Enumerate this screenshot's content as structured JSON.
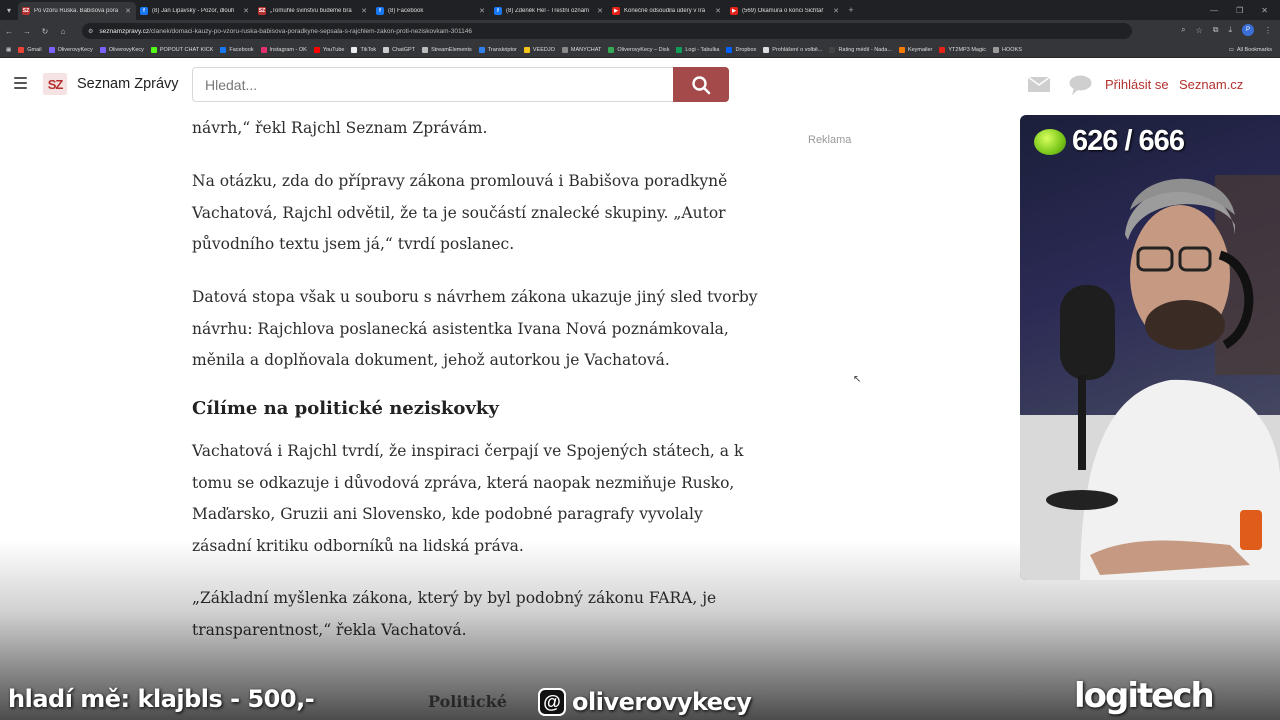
{
  "browser": {
    "tabs": [
      {
        "title": "Po vzoru Ruska. Babišova pora",
        "color": "#b5312f",
        "fav": "SZ",
        "active": true
      },
      {
        "title": "(8) Jan Lipavský - Pozor, dlouh",
        "color": "#1877f2",
        "fav": "f",
        "active": false
      },
      {
        "title": "„Tomuhle svinstvu budeme brá",
        "color": "#b5312f",
        "fav": "SZ",
        "active": false
      },
      {
        "title": "(8) Facebook",
        "color": "#1877f2",
        "fav": "f",
        "active": false
      },
      {
        "title": "(8) Zdeněk Hel - Trestní oznám",
        "color": "#1877f2",
        "fav": "f",
        "active": false
      },
      {
        "title": "Konečně odsoudila údery v Írá",
        "color": "#e62117",
        "fav": "▶",
        "active": false
      },
      {
        "title": "(569) Okamura o konci Šichtař",
        "color": "#e62117",
        "fav": "▶",
        "active": false
      }
    ],
    "new_tab": "+",
    "url_host": "seznamzpravy.cz",
    "url_path": "/clanek/domaci-kauzy-po-vzoru-ruska-babisova-poradkyne-sepsala-s-rajchlem-zakon-proti-neziskovkam-301146",
    "bookmarks": [
      {
        "label": "Gmail",
        "color": "#ea4335"
      },
      {
        "label": "OliverovyKecy",
        "color": "#7b61ff"
      },
      {
        "label": "OliverovyKecy",
        "color": "#7b61ff"
      },
      {
        "label": "POPOUT CHAT KICK",
        "color": "#53fc18"
      },
      {
        "label": "Facebook",
        "color": "#1877f2"
      },
      {
        "label": "Instagram - OK",
        "color": "#e1306c"
      },
      {
        "label": "YouTube",
        "color": "#ff0000"
      },
      {
        "label": "TikTok",
        "color": "#eeeeee"
      },
      {
        "label": "ChatGPT",
        "color": "#cccccc"
      },
      {
        "label": "StreamElements",
        "color": "#bbbbbb"
      },
      {
        "label": "Transkriptor",
        "color": "#2f80ed"
      },
      {
        "label": "VEEDJO",
        "color": "#f5c518"
      },
      {
        "label": "MANYCHAT",
        "color": "#888888"
      },
      {
        "label": "OliverovyKecy – Disk",
        "color": "#34a853"
      },
      {
        "label": "Logi - Tabulka",
        "color": "#0f9d58"
      },
      {
        "label": "Dropbox",
        "color": "#0061ff"
      },
      {
        "label": "Prohlášení o volbě...",
        "color": "#dddddd"
      },
      {
        "label": "Rating médií - Nada...",
        "color": "#444444"
      },
      {
        "label": "Keymailer",
        "color": "#f57c00"
      },
      {
        "label": "YT2MP3 Magic",
        "color": "#e62117"
      },
      {
        "label": "HOOKS",
        "color": "#999999"
      }
    ],
    "all_bookmarks": "All Bookmarks"
  },
  "site": {
    "logo": "SZ",
    "name": "Seznam Zprávy",
    "search_placeholder": "Hledat...",
    "login": "Přihlásit se",
    "seznam_link": "Seznam.cz",
    "ad_label": "Reklama"
  },
  "article": {
    "p0": "návrh,“ řekl Rajchl Seznam Zprávám.",
    "p1": "Na otázku, zda do přípravy zákona promlouvá i Babišova poradkyně Vachatová, Rajchl odvětil, že ta je součástí znalecké skupiny. „Autor původního textu jsem já,“ tvrdí poslanec.",
    "p2": "Datová stopa však u souboru s návrhem zákona ukazuje jiný sled tvorby návrhu: Rajchlova poslanecká asistentka Ivana Nová poznámkovala, měnila a doplňovala dokument, jehož autorkou je Vachatová.",
    "heading": "Cílíme na politické neziskovky",
    "p3": "Vachatová i Rajchl tvrdí, že inspiraci čerpají ve Spojených státech, a k tomu se odkazuje i důvodová zpráva, která naopak nezmiňuje Rusko, Maďarsko, Gruzii ani Slovensko, kde podobné paragrafy vyvolaly zásadní kritiku odborníků na lidská práva.",
    "p4": "„Základní myšlenka zákona, který by byl podobný zákonu FARA, je transparentnost,“ řekla Vachatová.",
    "related_partial": "Politické"
  },
  "stream": {
    "counter": "626 / 666",
    "ticker": "hladí mě: klajbls - 500,-",
    "threads_handle": "oliverovykecy",
    "sponsor": "logitech"
  }
}
